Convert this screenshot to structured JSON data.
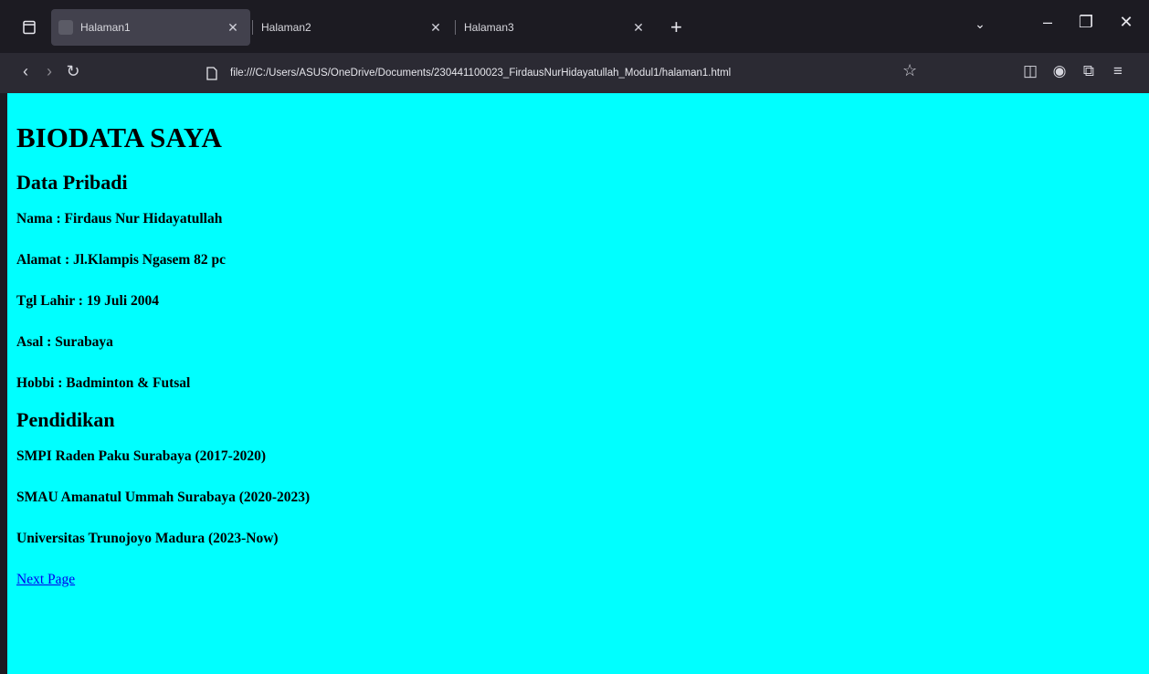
{
  "browser": {
    "tabs": [
      {
        "label": "Halaman1",
        "active": true
      },
      {
        "label": "Halaman2",
        "active": false
      },
      {
        "label": "Halaman3",
        "active": false
      }
    ],
    "url": "file:///C:/Users/ASUS/OneDrive/Documents/230441100023_FirdausNurHidayatullah_Modul1/halaman1.html",
    "icons": [
      "tab-list-icon",
      "close-icon",
      "new-tab-icon",
      "list-all-tabs-icon",
      "minimize-icon",
      "restore-icon",
      "window-close-icon",
      "back-icon",
      "forward-icon",
      "reload-icon",
      "page-icon",
      "bookmark-star-icon",
      "pocket-icon",
      "account-icon",
      "extensions-icon",
      "menu-icon"
    ]
  },
  "page": {
    "background": "#00ffff",
    "title": "BIODATA SAYA",
    "section1": {
      "heading": "Data Pribadi",
      "items": [
        "Nama : Firdaus Nur Hidayatullah",
        "Alamat : Jl.Klampis Ngasem 82 pc",
        "Tgl Lahir : 19 Juli 2004",
        "Asal : Surabaya",
        "Hobbi : Badminton & Futsal"
      ]
    },
    "section2": {
      "heading": "Pendidikan",
      "items": [
        "SMPI Raden Paku Surabaya (2017-2020)",
        "SMAU Amanatul Ummah Surabaya (2020-2023)",
        "Universitas Trunojoyo Madura (2023-Now)"
      ]
    },
    "link_label": "Next Page"
  }
}
